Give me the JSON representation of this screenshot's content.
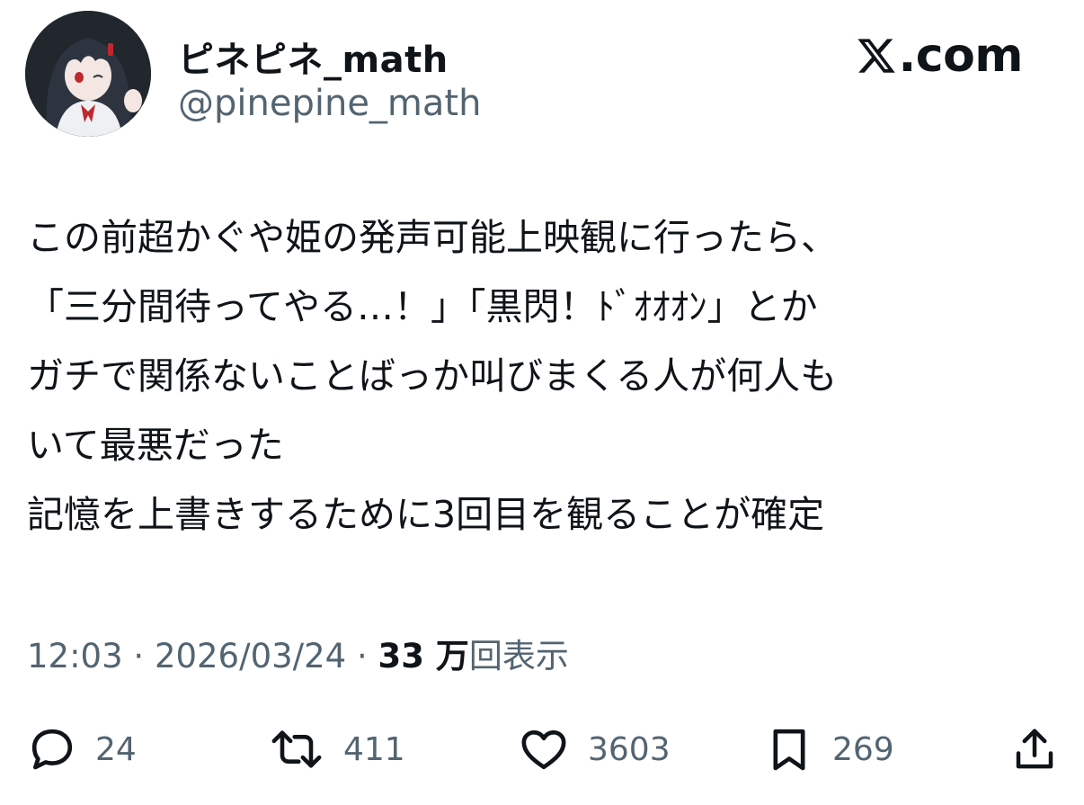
{
  "author": {
    "display_name": "ピネピネ_math",
    "handle": "@pinepine_math"
  },
  "brand": {
    "text": ".com",
    "icon": "x-logo-icon"
  },
  "tweet": {
    "lines": [
      "この前超かぐや姫の発声可能上映観に行ったら、",
      "「三分間待ってやる…！」「黒閃！ﾄﾞｵｵｵﾝ」とか",
      "ガチで関係ないことばっか叫びまくる人が何人も",
      "いて最悪だった",
      "記憶を上書きするために3回目を観ることが確定"
    ]
  },
  "meta": {
    "time": "12:03",
    "separator": "·",
    "date": "2026/03/24",
    "views_count": "33 万",
    "views_label": "回表示"
  },
  "actions": {
    "reply": {
      "icon": "reply-icon",
      "count": "24"
    },
    "repost": {
      "icon": "repost-icon",
      "count": "411"
    },
    "like": {
      "icon": "heart-icon",
      "count": "3603"
    },
    "bookmark": {
      "icon": "bookmark-icon",
      "count": "269"
    },
    "share": {
      "icon": "share-icon"
    }
  },
  "colors": {
    "text_primary": "#0f1419",
    "text_secondary": "#536471",
    "avatar_accent": "#c0282d"
  }
}
